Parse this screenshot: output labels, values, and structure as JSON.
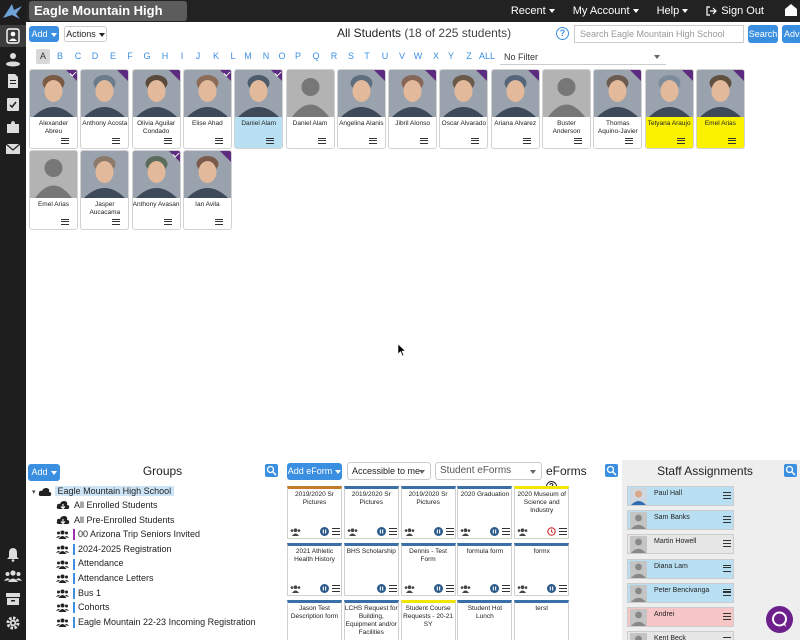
{
  "app": {
    "school_name": "Eagle Mountain High School",
    "colors": {
      "accent": "#3b8fe0",
      "purple_corner": "#5c2a7e",
      "selected_blue": "#b9e0f2",
      "yellow": "#fbf200",
      "topbar": "#222222"
    }
  },
  "topnav": {
    "recent": "Recent",
    "my_account": "My Account",
    "help": "Help",
    "sign_out": "Sign Out"
  },
  "toolbar": {
    "add_label": "Add",
    "actions_label": "Actions",
    "title": "All Students",
    "count": "(18 of 225 students)",
    "search_placeholder": "Search Eagle Mountain High School",
    "search_label": "Search",
    "advanced_label": "Advanced"
  },
  "alphabet": {
    "letters": [
      "A",
      "B",
      "C",
      "D",
      "E",
      "F",
      "G",
      "H",
      "I",
      "J",
      "K",
      "L",
      "M",
      "N",
      "O",
      "P",
      "Q",
      "R",
      "S",
      "T",
      "U",
      "V",
      "W",
      "X",
      "Y",
      "Z",
      "ALL"
    ],
    "selected": "A",
    "filter_value": "No Filter"
  },
  "students": [
    {
      "name": "Alexander Abreu",
      "photo": "photo",
      "corner": "check",
      "bg": ""
    },
    {
      "name": "Anthony Acosta",
      "photo": "photo",
      "corner": "plain",
      "bg": ""
    },
    {
      "name": "Olivia Aguilar Condado",
      "photo": "photo",
      "corner": "plain",
      "bg": ""
    },
    {
      "name": "Elise Ahad",
      "photo": "photo",
      "corner": "check",
      "bg": ""
    },
    {
      "name": "Daniel Alam",
      "photo": "photo",
      "corner": "check",
      "bg": "blue"
    },
    {
      "name": "Daniel Alam",
      "photo": "silhouette",
      "corner": "none",
      "bg": ""
    },
    {
      "name": "Angelina Alanis",
      "photo": "photo",
      "corner": "plain",
      "bg": ""
    },
    {
      "name": "Jibril Alonso",
      "photo": "photo",
      "corner": "plain",
      "bg": ""
    },
    {
      "name": "Oscar Alvarado",
      "photo": "photo",
      "corner": "plain",
      "bg": ""
    },
    {
      "name": "Ariana Alvarez",
      "photo": "photo",
      "corner": "plain",
      "bg": ""
    },
    {
      "name": "Buster Anderson",
      "photo": "silhouette",
      "corner": "none",
      "bg": ""
    },
    {
      "name": "Thomas Aquino-Javier",
      "photo": "photo",
      "corner": "plain",
      "bg": ""
    },
    {
      "name": "Tetyana Araujo",
      "photo": "photo",
      "corner": "plain",
      "bg": "yellow"
    },
    {
      "name": "Emel Arias",
      "photo": "photo",
      "corner": "plain",
      "bg": "yellow"
    },
    {
      "name": "Emel Arias",
      "photo": "silhouette",
      "corner": "none",
      "bg": ""
    },
    {
      "name": "Jasper Aucacama",
      "photo": "photo",
      "corner": "none",
      "bg": ""
    },
    {
      "name": "Anthony Avasan",
      "photo": "photo",
      "corner": "check",
      "bg": ""
    },
    {
      "name": "Ian Avila",
      "photo": "photo",
      "corner": "plain",
      "bg": ""
    }
  ],
  "groups": {
    "add_label": "Add",
    "title": "Groups",
    "root": "Eagle Mountain High School",
    "items": [
      {
        "label": "All Enrolled Students",
        "icon": "cloud-download-icon",
        "bar": ""
      },
      {
        "label": "All Pre-Enrolled Students",
        "icon": "cloud-download-icon",
        "bar": ""
      },
      {
        "label": "00 Arizona Trip Seniors Invited",
        "icon": "users-icon",
        "bar": "#9c2fae"
      },
      {
        "label": "2024-2025 Registration",
        "icon": "users-icon",
        "bar": "#3b8fe0"
      },
      {
        "label": "Attendance",
        "icon": "users-icon",
        "bar": "#3b8fe0"
      },
      {
        "label": "Attendance Letters",
        "icon": "users-icon",
        "bar": "#3b8fe0"
      },
      {
        "label": "Bus 1",
        "icon": "users-icon",
        "bar": "#3b8fe0"
      },
      {
        "label": "Cohorts",
        "icon": "users-icon",
        "bar": "#3b8fe0"
      },
      {
        "label": "Eagle Mountain 22-23 Incoming Registration",
        "icon": "users-icon",
        "bar": "#3b8fe0"
      }
    ]
  },
  "eforms": {
    "add_label": "Add eForm",
    "accessible_value": "Accessible to me",
    "type_value": "Student eForms",
    "title": "eForms",
    "tiles": [
      {
        "title": "2019/2020 Sr Pictures",
        "top": "#c47a2b",
        "icons": "full"
      },
      {
        "title": "2019/2020 Sr Pictures",
        "top": "#3b6fa8",
        "icons": "full"
      },
      {
        "title": "2019/2020 Sr Pictures",
        "top": "#3b6fa8",
        "icons": "full"
      },
      {
        "title": "2020 Graduation",
        "top": "#3b6fa8",
        "icons": "full"
      },
      {
        "title": "2020 Museum of Science and Industry",
        "top": "#f2e600",
        "icons": "clock"
      },
      {
        "title": "2021 Athletic Health History",
        "top": "#3b6fa8",
        "icons": "full"
      },
      {
        "title": "BHS Scholarship",
        "top": "#3b6fa8",
        "icons": "short"
      },
      {
        "title": "Dennis - Test Form",
        "top": "#3b6fa8",
        "icons": "full"
      },
      {
        "title": "formula form",
        "top": "#3b6fa8",
        "icons": "full"
      },
      {
        "title": "formx",
        "top": "#3b6fa8",
        "icons": "full"
      },
      {
        "title": "Jason Test Description form",
        "top": "#3b6fa8",
        "icons": "none"
      },
      {
        "title": "LCHS Request for Building, Equipment and/or Facilities",
        "top": "#3b6fa8",
        "icons": "none"
      },
      {
        "title": "Student Course Requests - 20-21 SY",
        "top": "#f2e600",
        "icons": "none"
      },
      {
        "title": "Student Hot Lunch",
        "top": "#3b6fa8",
        "icons": "none"
      },
      {
        "title": "terst",
        "top": "#3b6fa8",
        "icons": "none"
      }
    ]
  },
  "staff": {
    "title": "Staff Assignments",
    "people": [
      {
        "name": "Paul Hall",
        "bg": "#b9e0f2",
        "photo": "photo"
      },
      {
        "name": "Sam Banks",
        "bg": "#b9e0f2",
        "photo": "silhouette"
      },
      {
        "name": "Martin Howell",
        "bg": "#e6e6e6",
        "photo": "silhouette"
      },
      {
        "name": "Diana Lam",
        "bg": "#b9e0f2",
        "photo": "silhouette"
      },
      {
        "name": "Peter Bencivanga",
        "bg": "#b9e0f2",
        "photo": "silhouette"
      },
      {
        "name": "Andrei",
        "bg": "#f6c6c6",
        "photo": "silhouette"
      },
      {
        "name": "Kent Beck",
        "bg": "#e6e6e6",
        "photo": "silhouette"
      }
    ]
  }
}
